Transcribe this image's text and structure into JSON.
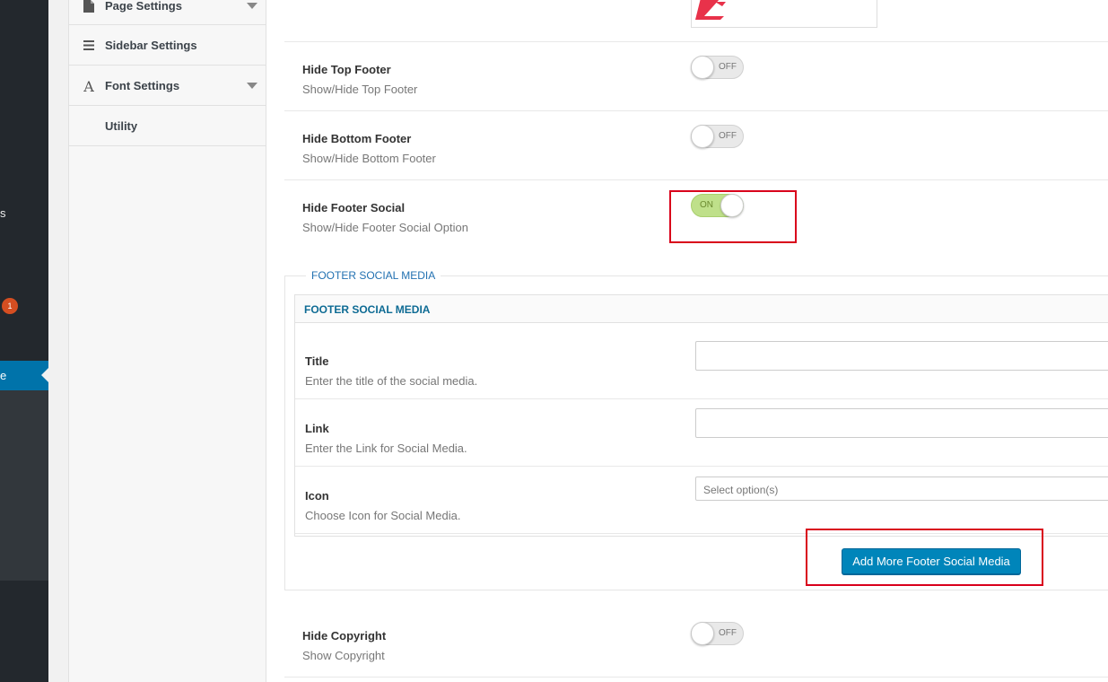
{
  "wp_admin": {
    "menu_fragment_s": "s",
    "badge_count": "1",
    "active_fragment": "e"
  },
  "options_menu": {
    "items": [
      {
        "label": "Page Settings",
        "icon": "page-icon",
        "has_caret": true
      },
      {
        "label": "Sidebar Settings",
        "icon": "menu-lines-icon",
        "has_caret": false
      },
      {
        "label": "Font Settings",
        "icon": "font-icon",
        "icon_glyph": "A",
        "has_caret": true
      },
      {
        "label": "Utility",
        "icon": "",
        "has_caret": false
      }
    ]
  },
  "footer": {
    "hide_top_footer": {
      "title": "Hide Top Footer",
      "desc": "Show/Hide Top Footer",
      "state": "OFF"
    },
    "hide_bottom_footer": {
      "title": "Hide Bottom Footer",
      "desc": "Show/Hide Bottom Footer",
      "state": "OFF"
    },
    "hide_footer_social": {
      "title": "Hide Footer Social",
      "desc": "Show/Hide Footer Social Option",
      "state": "ON"
    },
    "social_media": {
      "legend": "FOOTER SOCIAL MEDIA",
      "panel_title": "FOOTER SOCIAL MEDIA",
      "title_field": {
        "title": "Title",
        "desc": "Enter the title of the social media.",
        "value": ""
      },
      "link_field": {
        "title": "Link",
        "desc": "Enter the Link for Social Media.",
        "value": ""
      },
      "icon_field": {
        "title": "Icon",
        "desc": "Choose Icon for Social Media.",
        "placeholder": "Select option(s)"
      },
      "add_button": "Add More Footer Social Media"
    },
    "hide_copyright": {
      "title": "Hide Copyright",
      "desc": "Show Copyright",
      "state": "OFF"
    }
  },
  "colors": {
    "wp_sidebar": "#23282d",
    "wp_active": "#0073aa",
    "toggle_on": "#bfe08a",
    "button_primary": "#0085ba",
    "highlight": "#d9001b",
    "logo_accent": "#e8324a"
  }
}
